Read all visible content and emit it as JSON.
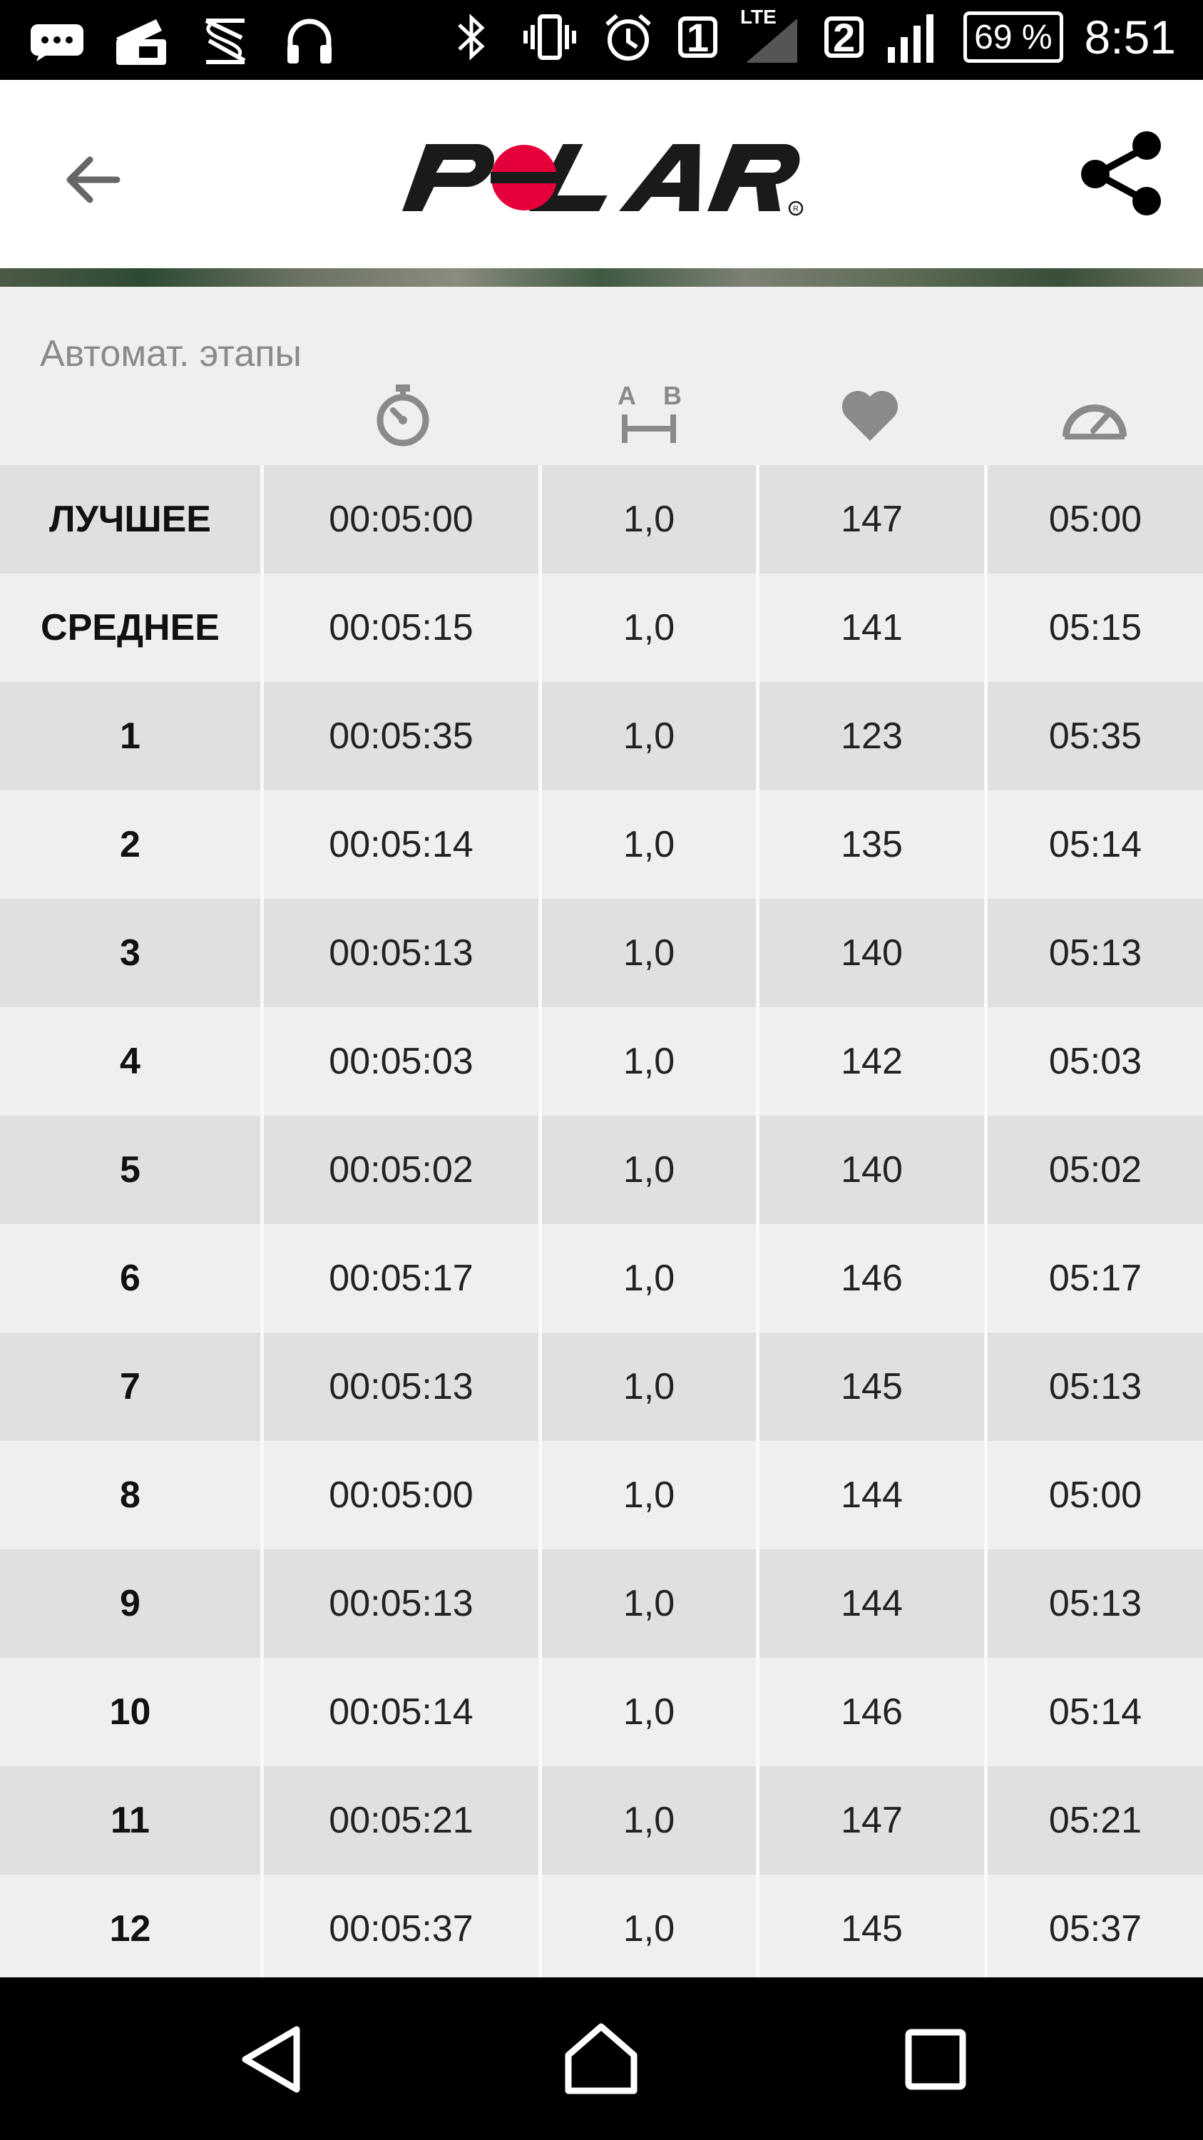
{
  "status_bar": {
    "sim1_label": "1",
    "network_type": "LTE",
    "sim2_label": "2",
    "battery": "69 %",
    "time": "8:51",
    "left_icons": [
      "message-icon",
      "bag-icon",
      "s-app-icon",
      "headphones-icon"
    ],
    "right_icons": [
      "bluetooth-icon",
      "vibrate-icon",
      "alarm-icon",
      "signal-icon"
    ]
  },
  "app_bar": {
    "logo_text": "POLAR",
    "logo_color": "#e5003c"
  },
  "laps": {
    "title": "Автомат. этапы",
    "column_icons": [
      "stopwatch-icon",
      "distance-icon",
      "heart-icon",
      "pace-gauge-icon"
    ],
    "distance_icon_labels": {
      "a": "A",
      "b": "B"
    },
    "rows": [
      {
        "label": "ЛУЧШЕЕ",
        "time": "00:05:00",
        "distance": "1,0",
        "hr": "147",
        "pace": "05:00"
      },
      {
        "label": "СРЕДНЕЕ",
        "time": "00:05:15",
        "distance": "1,0",
        "hr": "141",
        "pace": "05:15"
      },
      {
        "label": "1",
        "time": "00:05:35",
        "distance": "1,0",
        "hr": "123",
        "pace": "05:35"
      },
      {
        "label": "2",
        "time": "00:05:14",
        "distance": "1,0",
        "hr": "135",
        "pace": "05:14"
      },
      {
        "label": "3",
        "time": "00:05:13",
        "distance": "1,0",
        "hr": "140",
        "pace": "05:13"
      },
      {
        "label": "4",
        "time": "00:05:03",
        "distance": "1,0",
        "hr": "142",
        "pace": "05:03"
      },
      {
        "label": "5",
        "time": "00:05:02",
        "distance": "1,0",
        "hr": "140",
        "pace": "05:02"
      },
      {
        "label": "6",
        "time": "00:05:17",
        "distance": "1,0",
        "hr": "146",
        "pace": "05:17"
      },
      {
        "label": "7",
        "time": "00:05:13",
        "distance": "1,0",
        "hr": "145",
        "pace": "05:13"
      },
      {
        "label": "8",
        "time": "00:05:00",
        "distance": "1,0",
        "hr": "144",
        "pace": "05:00"
      },
      {
        "label": "9",
        "time": "00:05:13",
        "distance": "1,0",
        "hr": "144",
        "pace": "05:13"
      },
      {
        "label": "10",
        "time": "00:05:14",
        "distance": "1,0",
        "hr": "146",
        "pace": "05:14"
      },
      {
        "label": "11",
        "time": "00:05:21",
        "distance": "1,0",
        "hr": "147",
        "pace": "05:21"
      },
      {
        "label": "12",
        "time": "00:05:37",
        "distance": "1,0",
        "hr": "145",
        "pace": "05:37"
      }
    ]
  },
  "nav_bar": {
    "buttons": [
      "back-nav-icon",
      "home-nav-icon",
      "recents-nav-icon"
    ]
  }
}
